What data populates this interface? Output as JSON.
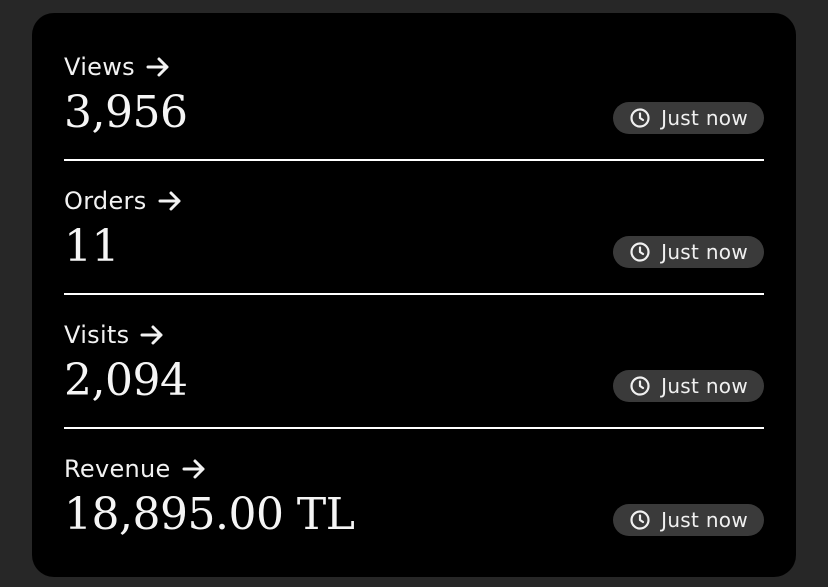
{
  "metrics": [
    {
      "label": "Views",
      "value": "3,956",
      "updated": "Just now"
    },
    {
      "label": "Orders",
      "value": "11",
      "updated": "Just now"
    },
    {
      "label": "Visits",
      "value": "2,094",
      "updated": "Just now"
    },
    {
      "label": "Revenue",
      "value": "18,895.00 TL",
      "updated": "Just now"
    }
  ],
  "icons": {
    "link": "arrow-right-icon",
    "timestamp": "clock-icon"
  },
  "colors": {
    "background": "#272727",
    "card": "#000000",
    "text": "#f2f2f2",
    "badge": "#3a3a3a",
    "divider": "#ffffff"
  }
}
